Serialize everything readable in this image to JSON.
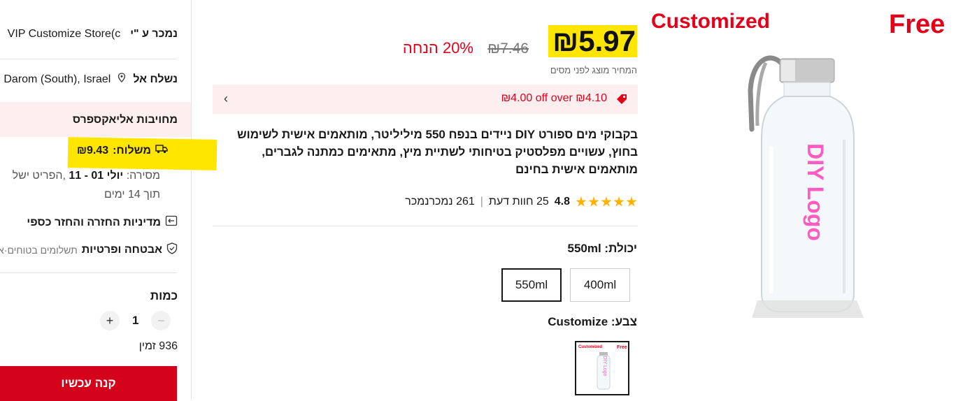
{
  "product_image": {
    "overlay_left": "Customized",
    "overlay_right": "Free",
    "logo_text": "DIY Logo"
  },
  "price": {
    "current": "₪5.97",
    "original": "₪7.46",
    "discount": "20% הנחה",
    "tax_note": "המחיר מוצג לפני מסים"
  },
  "coupon": {
    "text": "₪4.00 off over ₪4.10"
  },
  "product": {
    "title": "בקבוקי מים ספורט DIY ניידים בנפח 550 מיליליטר, מותאמים אישית לשימוש בחוץ, עשויים מפלסטיק בטיחותי לשתיית מיץ, מתאימים כמתנה לגברים, מותאמים אישית בחינם",
    "rating": "4.8",
    "reviews": "25 חוות דעת",
    "sold": "261 נמכרנמכר"
  },
  "options": {
    "capacity_label": "יכולת:",
    "capacity_value": "550ml",
    "capacity_options": [
      "400ml",
      "550ml"
    ],
    "color_label": "צבע:",
    "color_value": "Customize"
  },
  "sidebar": {
    "sold_by_label": "נמכר ע \"י",
    "store_name": "VIP Customize Store(c",
    "ship_to_label": "נשלח אל",
    "ship_to_value": "Darom (South), Israel",
    "commitment_title": "מחויבות אליאקספרס",
    "shipping_label": "משלוח:",
    "shipping_cost": "₪9.43",
    "delivery_line1_prefix": "מסירה:",
    "delivery_dates": "יולי 01 - 11",
    "delivery_line1_suffix": ",הפריט ישל",
    "delivery_line2": "תוך 14 ימים",
    "return_policy": "מדיניות החזרה והחזר כספי",
    "security_title": "אבטחה ופרטיות",
    "security_sub": "תשלומים בטוחים·א",
    "quantity_label": "כמות",
    "quantity_value": "1",
    "available": "936 זמין",
    "buy_now": "קנה עכשיו"
  },
  "colors": {
    "accent_red": "#d3031c",
    "highlight_yellow": "#ffe600",
    "star": "#ffb300"
  }
}
